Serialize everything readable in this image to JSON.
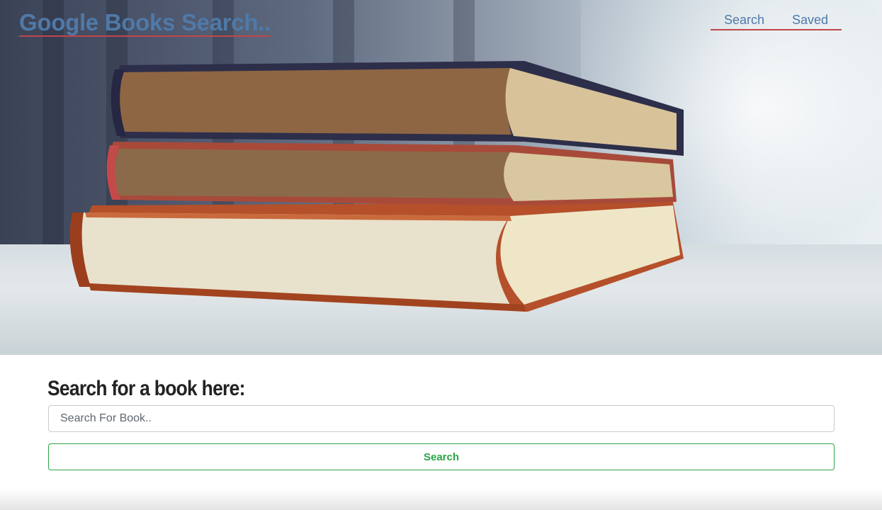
{
  "header": {
    "brand": "Google Books Search..",
    "nav": [
      {
        "label": "Search"
      },
      {
        "label": "Saved"
      }
    ]
  },
  "search": {
    "heading": "Search for a book here:",
    "placeholder": "Search For Book..",
    "value": "",
    "button_label": "Search"
  },
  "colors": {
    "link": "#4f79a8",
    "underline": "#c0474a",
    "button_accent": "#28a745"
  }
}
